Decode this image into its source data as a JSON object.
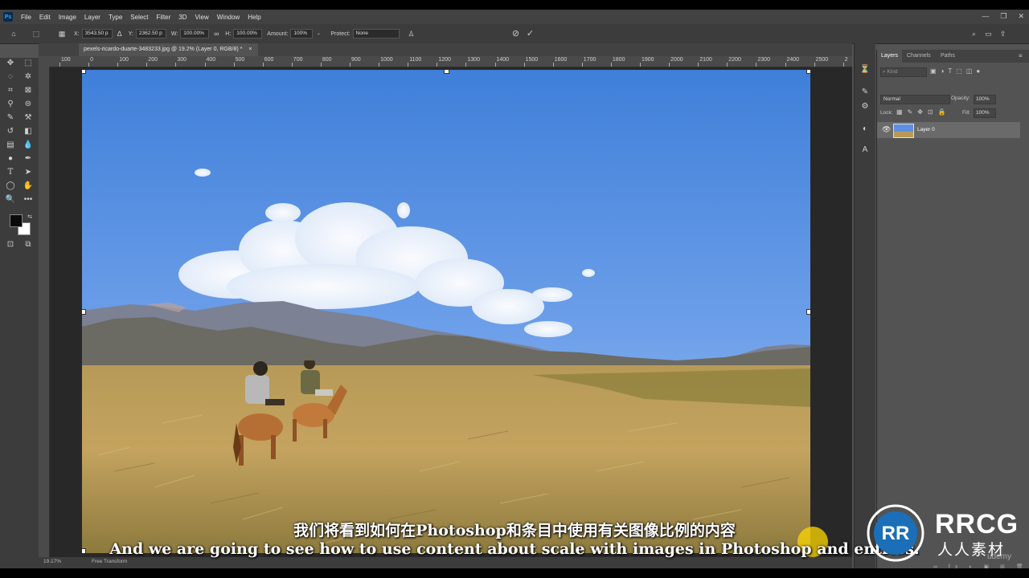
{
  "app": {
    "logo": "Ps"
  },
  "menubar": {
    "items": [
      "File",
      "Edit",
      "Image",
      "Layer",
      "Type",
      "Select",
      "Filter",
      "3D",
      "View",
      "Window",
      "Help"
    ]
  },
  "options": {
    "x_label": "X:",
    "x_value": "3543.50 p",
    "y_label": "Y:",
    "y_value": "2362.50 p",
    "w_label": "W:",
    "w_value": "100.00%",
    "h_label": "H:",
    "h_value": "100.00%",
    "amount_label": "Amount:",
    "amount_value": "100%",
    "protect_label": "Protect:",
    "protect_value": "None"
  },
  "document": {
    "tab_title": "pexels-ricardo-duarte-3483233.jpg @ 19.2% (Layer 0, RGB/8) *"
  },
  "ruler": {
    "ticks": [
      "100",
      "0",
      "100",
      "200",
      "300",
      "400",
      "500",
      "600",
      "700",
      "800",
      "900",
      "1000",
      "1100",
      "1200",
      "1300",
      "1400",
      "1500",
      "1600",
      "1700",
      "1800",
      "1900",
      "2000",
      "2100",
      "2200",
      "2300",
      "2400",
      "2500",
      "2"
    ]
  },
  "status": {
    "zoom": "19.17%",
    "mode": "Free Transform"
  },
  "layers_panel": {
    "tabs": [
      "Layers",
      "Channels",
      "Paths"
    ],
    "filter_placeholder": "Kind",
    "blend_mode": "Normal",
    "opacity_label": "Opacity:",
    "opacity_value": "100%",
    "lock_label": "Lock:",
    "fill_label": "Fill:",
    "fill_value": "100%",
    "layers": [
      {
        "name": "Layer 0",
        "visible": true
      }
    ]
  },
  "subtitles": {
    "chinese": "我们将看到如何在Photoshop和条目中使用有关图像比例的内容",
    "english": "And we are going to see how to use content about scale with images in Photoshop and entries."
  },
  "watermark": {
    "line1": "RRCG",
    "line2": "人人素材",
    "udemy": "udemy"
  },
  "colors": {
    "accent": "#31a8ff",
    "ui_bg": "#535353",
    "panel_bg": "#3c3c3c"
  }
}
